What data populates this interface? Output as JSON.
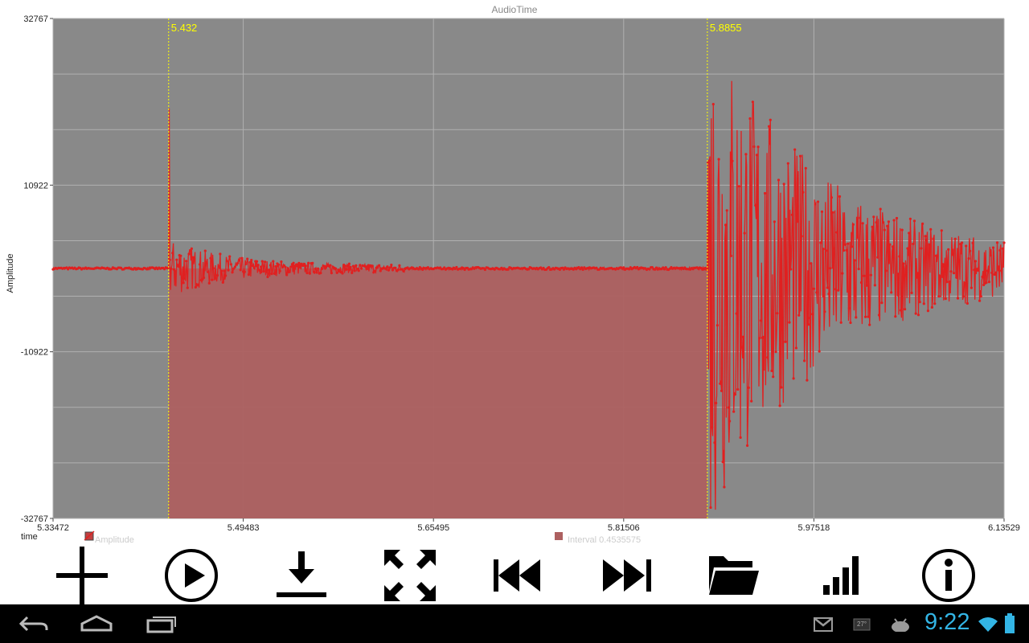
{
  "chart_data": {
    "type": "line",
    "title": "AudioTime",
    "xlabel": "time",
    "ylabel": "Amplitude",
    "xlim": [
      5.33472,
      6.13529
    ],
    "ylim": [
      -32767,
      32767
    ],
    "x_ticks": [
      "5.33472",
      "5.49483",
      "5.65495",
      "5.81506",
      "5.97518",
      "6.13529"
    ],
    "y_ticks": [
      "32767",
      "10922",
      "-10922",
      "-32767"
    ],
    "grid": true,
    "series": [
      {
        "name": "Amplitude",
        "color": "#e02020",
        "description": "audio waveform: flat near 0 until ~5.432, small transient at 5.432, decaying ripple, flat until ~5.8855, then large clipping burst decaying toward ~6.1"
      }
    ],
    "interval": {
      "name": "Interval 0.4535575",
      "start": 5.432,
      "end": 5.8855,
      "start_label": "5.432",
      "end_label": "5.8855",
      "color": "#b25a5a"
    },
    "legend": [
      "Amplitude",
      "Interval 0.4535575"
    ]
  },
  "toolbar": [
    {
      "name": "add-icon"
    },
    {
      "name": "play-icon"
    },
    {
      "name": "download-icon"
    },
    {
      "name": "fullscreen-icon"
    },
    {
      "name": "skip-previous-icon"
    },
    {
      "name": "skip-next-icon"
    },
    {
      "name": "folder-open-icon"
    },
    {
      "name": "signal-bars-icon"
    },
    {
      "name": "info-icon"
    }
  ],
  "navbar": {
    "clock": "9:22",
    "temperature": "27°"
  },
  "colors": {
    "plot_bg": "#898989",
    "grid": "#b5b5b5",
    "waveform": "#e02020",
    "interval_fill": "#ad6060",
    "marker": "#ffff00",
    "clock": "#33b5e5"
  }
}
